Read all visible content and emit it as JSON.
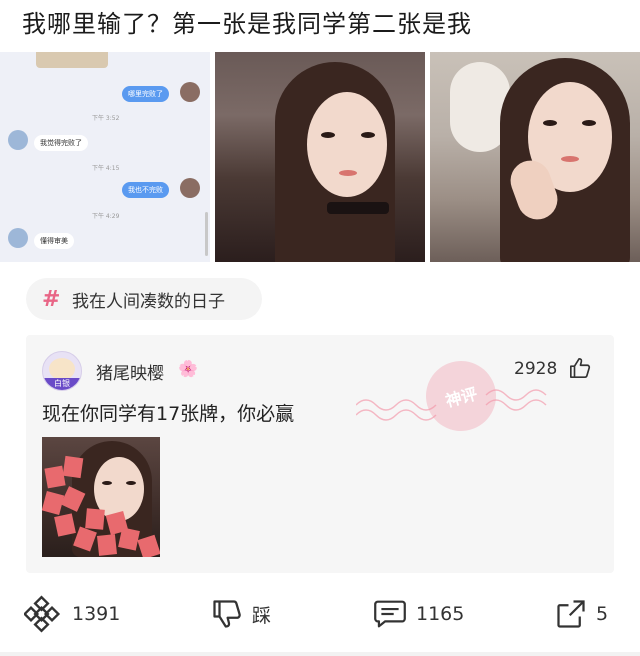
{
  "post": {
    "title": "我哪里输了？第一张是我同学第二张是我"
  },
  "chat": {
    "msg1": "哪里完败了",
    "time1": "下午 3:52",
    "msg2": "我觉得完败了",
    "time2": "下午 4:15",
    "msg3": "我也不完败",
    "time3": "下午 4:29",
    "msg4": "懂得审美"
  },
  "topic": {
    "icon": "hash-icon",
    "label": "我在人间凑数的日子"
  },
  "hot_comment": {
    "avatar_badge": "白银",
    "username": "猪尾映樱",
    "username_emoji": "🌸",
    "likes": "2928",
    "text": "现在你同学有17张牌，你必赢",
    "stamp": "神评"
  },
  "actions": {
    "share_icon": "diamond-share-icon",
    "likes": "1391",
    "dislike_label": "踩",
    "comments": "1165",
    "shares": "5"
  },
  "colors": {
    "accent": "#e86586",
    "bubble_blue": "#5a9af0"
  }
}
